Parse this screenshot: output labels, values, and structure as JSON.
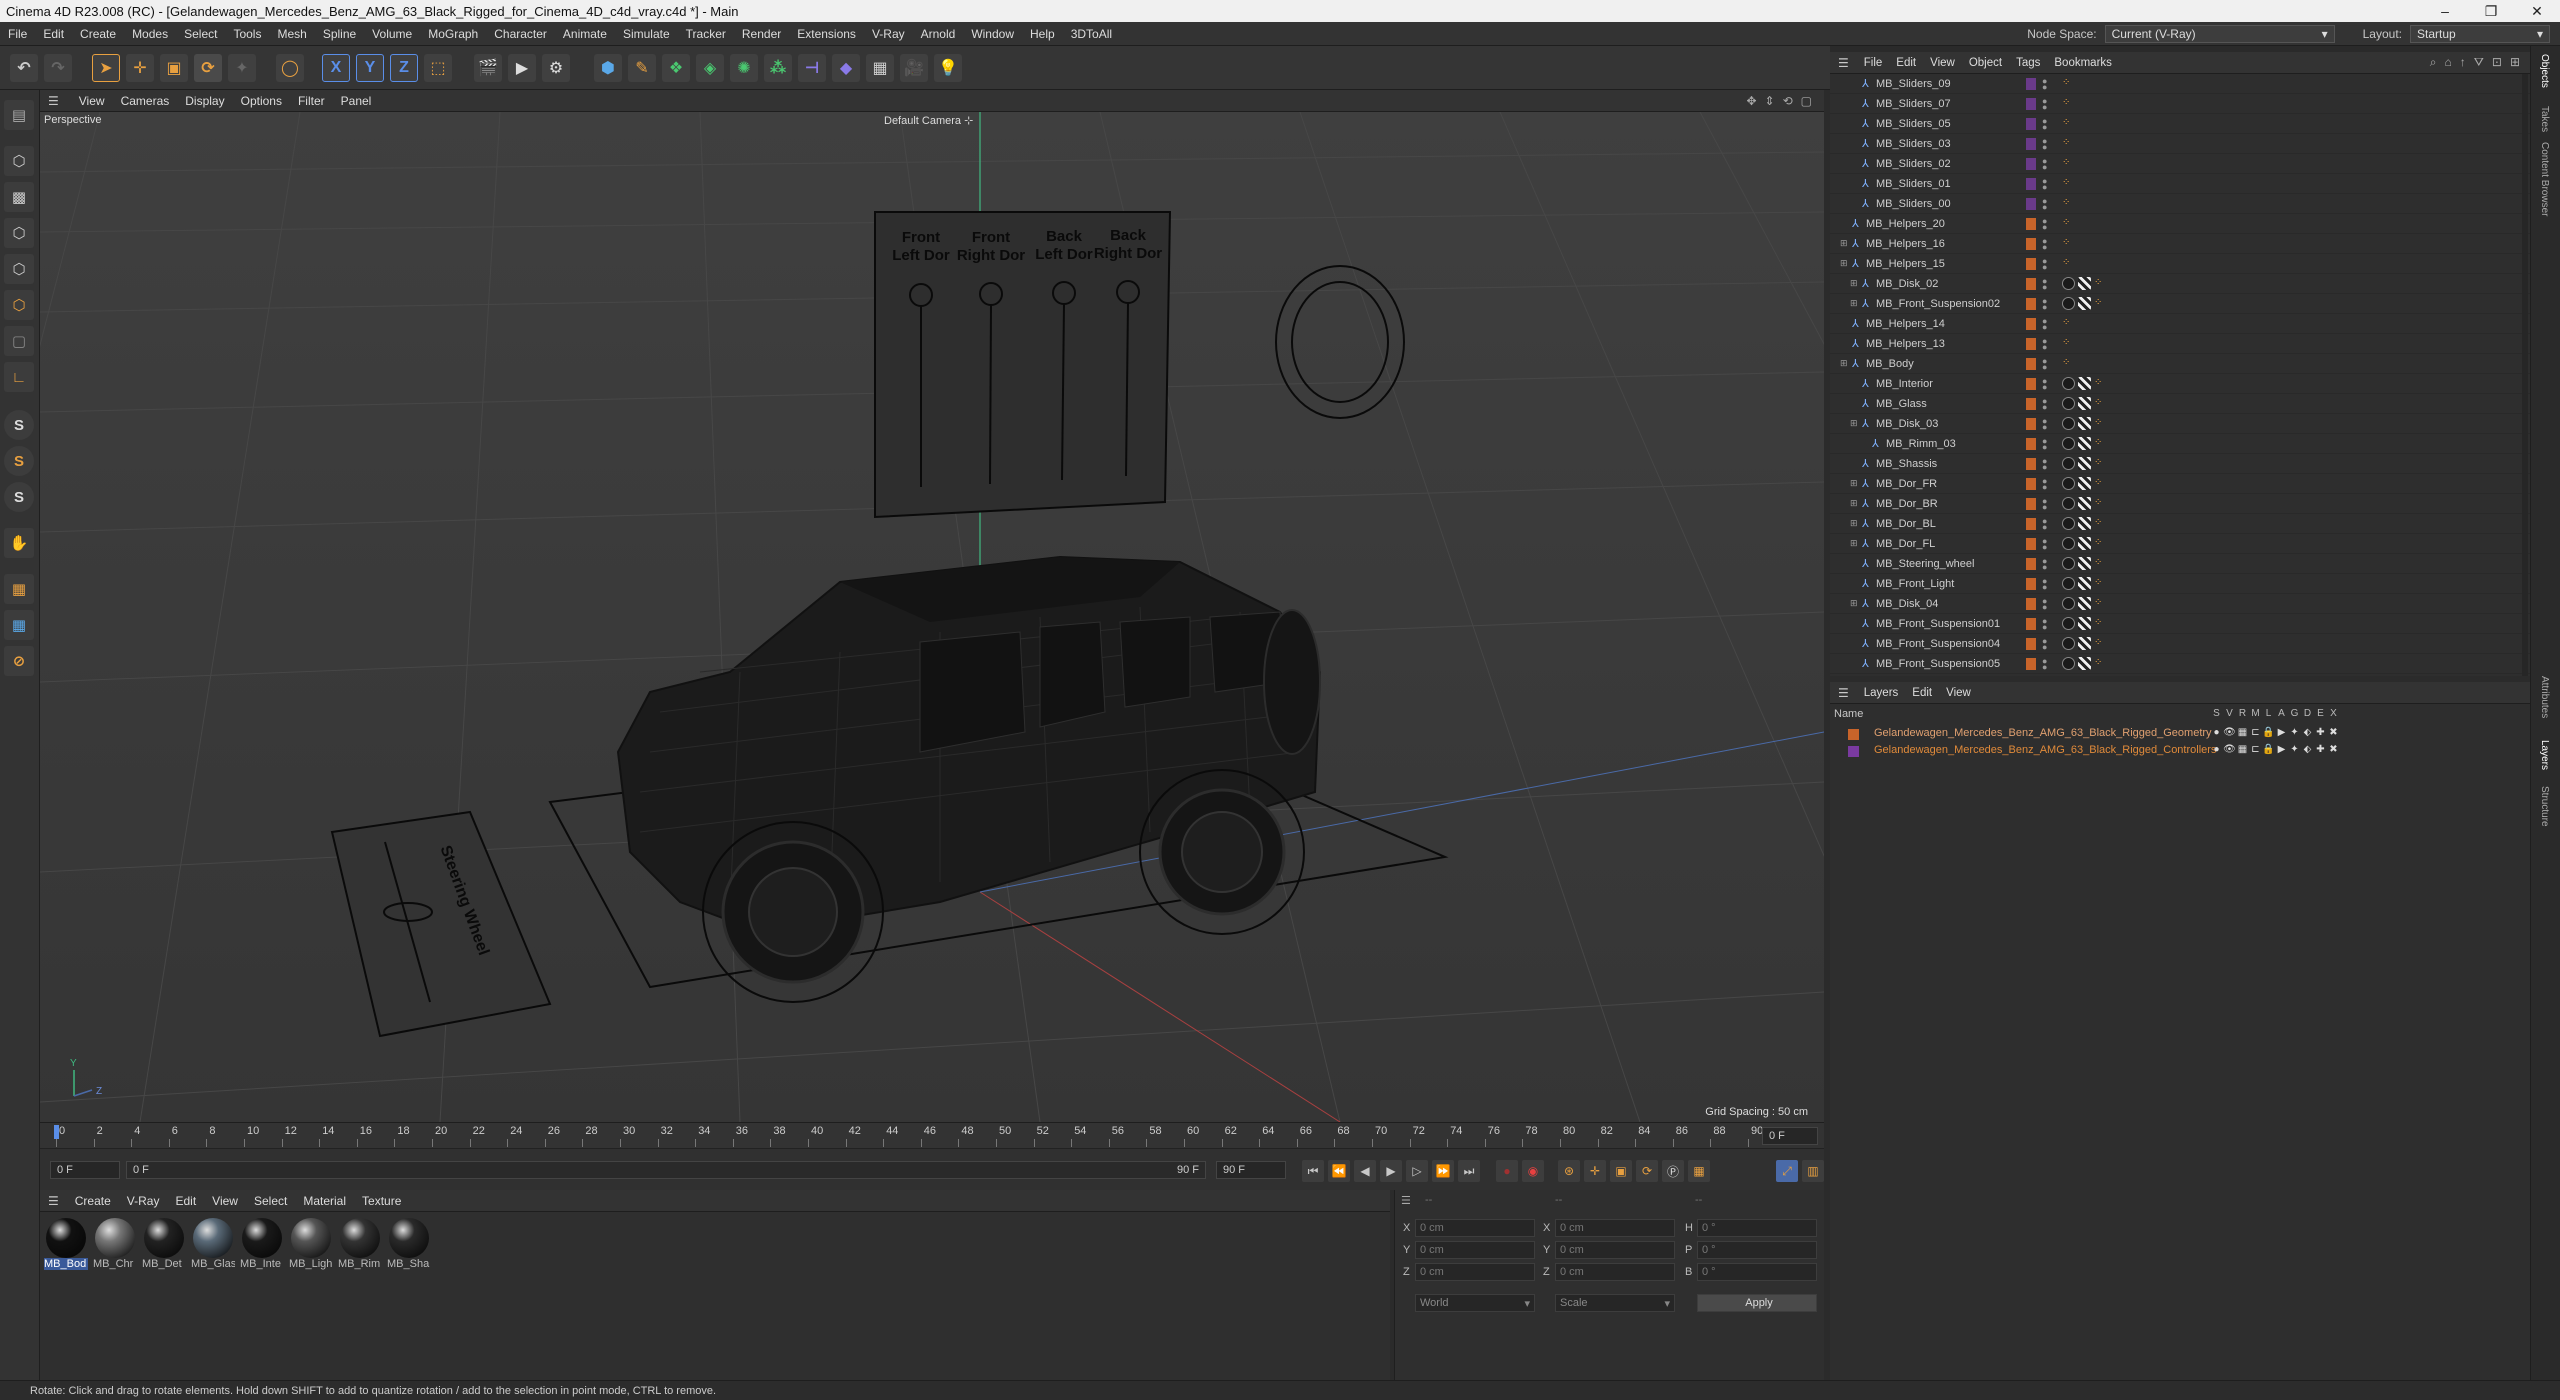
{
  "window": {
    "title": "Cinema 4D R23.008 (RC) - [Gelandewagen_Mercedes_Benz_AMG_63_Black_Rigged_for_Cinema_4D_c4d_vray.c4d *] - Main",
    "min": "–",
    "max": "❐",
    "close": "✕"
  },
  "menubar": {
    "items": [
      "File",
      "Edit",
      "Create",
      "Modes",
      "Select",
      "Tools",
      "Mesh",
      "Spline",
      "Volume",
      "MoGraph",
      "Character",
      "Animate",
      "Simulate",
      "Tracker",
      "Render",
      "Extensions",
      "V-Ray",
      "Arnold",
      "Window",
      "Help",
      "3DToAll"
    ],
    "node_space_label": "Node Space:",
    "node_space_value": "Current (V-Ray)",
    "layout_label": "Layout:",
    "layout_value": "Startup"
  },
  "toolbar": {
    "x_label": "X",
    "y_label": "Y",
    "z_label": "Z"
  },
  "lefttools": {
    "s1": "S",
    "s2": "S",
    "s3": "S"
  },
  "viewport": {
    "menu": [
      "View",
      "Cameras",
      "Display",
      "Options",
      "Filter",
      "Panel"
    ],
    "label": "Perspective",
    "camera": "Default Camera",
    "grid_spacing": "Grid Spacing : 50 cm",
    "sign_front_left": [
      "Front",
      "Left Dor"
    ],
    "sign_front_right": [
      "Front",
      "Right Dor"
    ],
    "sign_back_left": [
      "Back",
      "Left Dor"
    ],
    "sign_back_right": [
      "Back",
      "Right Dor"
    ],
    "steering_label": "Steering Wheel",
    "axis_y": "Y",
    "axis_z": "Z"
  },
  "timeline": {
    "ticks": [
      "0",
      "2",
      "4",
      "6",
      "8",
      "10",
      "12",
      "14",
      "16",
      "18",
      "20",
      "22",
      "24",
      "26",
      "28",
      "30",
      "32",
      "34",
      "36",
      "38",
      "40",
      "42",
      "44",
      "46",
      "48",
      "50",
      "52",
      "54",
      "56",
      "58",
      "60",
      "62",
      "64",
      "66",
      "68",
      "70",
      "72",
      "74",
      "76",
      "78",
      "80",
      "82",
      "84",
      "86",
      "88",
      "90"
    ],
    "current": "0 F"
  },
  "transport": {
    "start": "0 F",
    "range_start": "0 F",
    "range_end": "90 F",
    "end": "90 F"
  },
  "materials": {
    "menu": [
      "Create",
      "V-Ray",
      "Edit",
      "View",
      "Select",
      "Material",
      "Texture"
    ],
    "items": [
      {
        "label": "MB_Bod",
        "color": "#111"
      },
      {
        "label": "MB_Chr",
        "color": "#777"
      },
      {
        "label": "MB_Det",
        "color": "#222"
      },
      {
        "label": "MB_Glas",
        "color": "#5a6a78"
      },
      {
        "label": "MB_Inte",
        "color": "#1a1a1a"
      },
      {
        "label": "MB_Ligh",
        "color": "#555"
      },
      {
        "label": "MB_Rim",
        "color": "#333"
      },
      {
        "label": "MB_Sha",
        "color": "#2a2a2a"
      }
    ]
  },
  "coords": {
    "header1": "--",
    "header2": "--",
    "header3": "--",
    "x": "X",
    "y": "Y",
    "z": "Z",
    "x2": "X",
    "y2": "Y",
    "z2": "Z",
    "h": "H",
    "p": "P",
    "b": "B",
    "val_cm": "0 cm",
    "val_deg": "0 °",
    "world": "World",
    "scale": "Scale",
    "apply": "Apply"
  },
  "status": "Rotate: Click and drag to rotate elements. Hold down SHIFT to add to quantize rotation / add to the selection in point mode, CTRL to remove.",
  "objects_menu": [
    "File",
    "Edit",
    "View",
    "Object",
    "Tags",
    "Bookmarks"
  ],
  "objects": [
    {
      "name": "MB_Sliders_09",
      "indent": 2,
      "layer": "#6a3a8a"
    },
    {
      "name": "MB_Sliders_07",
      "indent": 2,
      "layer": "#6a3a8a"
    },
    {
      "name": "MB_Sliders_05",
      "indent": 2,
      "layer": "#6a3a8a"
    },
    {
      "name": "MB_Sliders_03",
      "indent": 2,
      "layer": "#6a3a8a"
    },
    {
      "name": "MB_Sliders_02",
      "indent": 2,
      "layer": "#6a3a8a"
    },
    {
      "name": "MB_Sliders_01",
      "indent": 2,
      "layer": "#6a3a8a"
    },
    {
      "name": "MB_Sliders_00",
      "indent": 2,
      "layer": "#6a3a8a"
    },
    {
      "name": "MB_Helpers_20",
      "indent": 1,
      "layer": "#c8642a"
    },
    {
      "name": "MB_Helpers_16",
      "indent": 1,
      "layer": "#c8642a"
    },
    {
      "name": "MB_Helpers_15",
      "indent": 1,
      "layer": "#c8642a"
    },
    {
      "name": "MB_Disk_02",
      "indent": 2,
      "layer": "#c8642a"
    },
    {
      "name": "MB_Front_Suspension02",
      "indent": 2,
      "layer": "#c8642a"
    },
    {
      "name": "MB_Helpers_14",
      "indent": 1,
      "layer": "#c8642a"
    },
    {
      "name": "MB_Helpers_13",
      "indent": 1,
      "layer": "#c8642a"
    },
    {
      "name": "MB_Body",
      "indent": 1,
      "layer": "#c8642a"
    },
    {
      "name": "MB_Interior",
      "indent": 2,
      "layer": "#c8642a"
    },
    {
      "name": "MB_Glass",
      "indent": 2,
      "layer": "#c8642a"
    },
    {
      "name": "MB_Disk_03",
      "indent": 2,
      "layer": "#c8642a"
    },
    {
      "name": "MB_Rimm_03",
      "indent": 3,
      "layer": "#c8642a"
    },
    {
      "name": "MB_Shassis",
      "indent": 2,
      "layer": "#c8642a"
    },
    {
      "name": "MB_Dor_FR",
      "indent": 2,
      "layer": "#c8642a"
    },
    {
      "name": "MB_Dor_BR",
      "indent": 2,
      "layer": "#c8642a"
    },
    {
      "name": "MB_Dor_BL",
      "indent": 2,
      "layer": "#c8642a"
    },
    {
      "name": "MB_Dor_FL",
      "indent": 2,
      "layer": "#c8642a"
    },
    {
      "name": "MB_Steering_wheel",
      "indent": 2,
      "layer": "#c8642a"
    },
    {
      "name": "MB_Front_Light",
      "indent": 2,
      "layer": "#c8642a"
    },
    {
      "name": "MB_Disk_04",
      "indent": 2,
      "layer": "#c8642a"
    },
    {
      "name": "MB_Front_Suspension01",
      "indent": 2,
      "layer": "#c8642a"
    },
    {
      "name": "MB_Front_Suspension04",
      "indent": 2,
      "layer": "#c8642a"
    },
    {
      "name": "MB_Front_Suspension05",
      "indent": 2,
      "layer": "#c8642a"
    }
  ],
  "layers_menu": [
    "Layers",
    "Edit",
    "View"
  ],
  "layers_header": {
    "name": "Name",
    "cols": [
      "S",
      "V",
      "R",
      "M",
      "L",
      "A",
      "G",
      "D",
      "E",
      "X"
    ]
  },
  "layers": [
    {
      "name": "Gelandewagen_Mercedes_Benz_AMG_63_Black_Rigged_Geometry",
      "color": "#c8642a",
      "text": "#e0a070"
    },
    {
      "name": "Gelandewagen_Mercedes_Benz_AMG_63_Black_Rigged_Controllers",
      "color": "#7a3aa0",
      "text": "#e08a3a"
    }
  ],
  "right_tabs": [
    "Objects",
    "Takes",
    "Content Browser",
    "Attributes",
    "Layers",
    "Structure"
  ]
}
